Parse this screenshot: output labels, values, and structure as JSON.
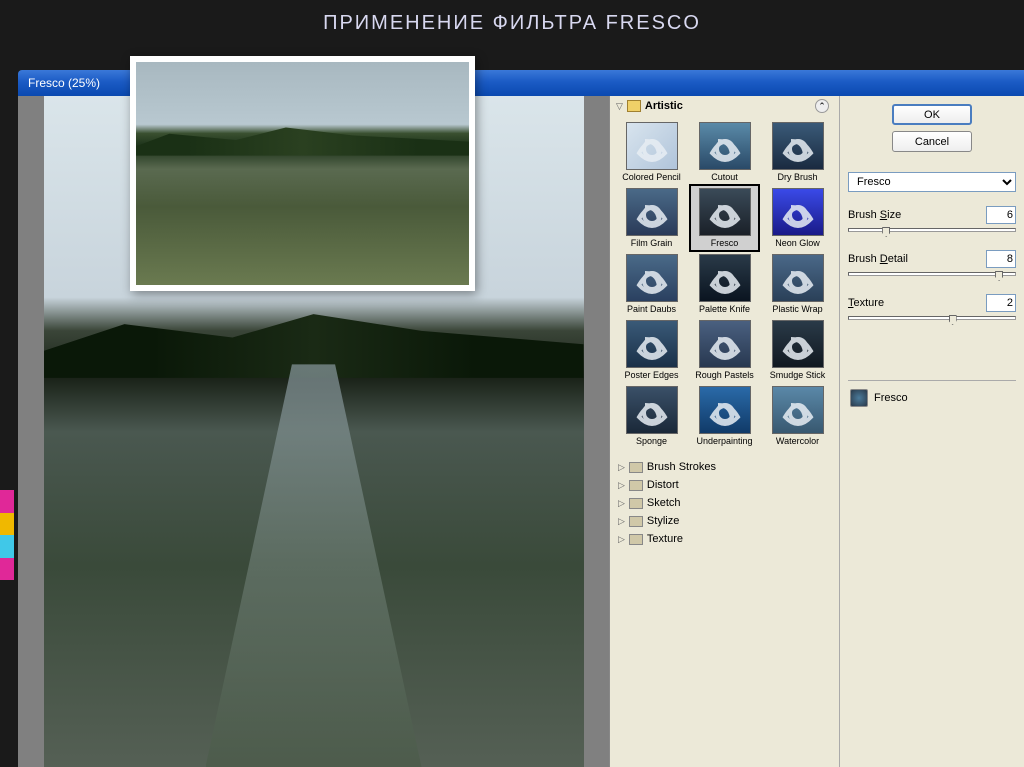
{
  "slide": {
    "title": "ПРИМЕНЕНИЕ ФИЛЬТРА FRESCO"
  },
  "window": {
    "title": "Fresco (25%)"
  },
  "panel": {
    "category_open": "Artistic",
    "filters": [
      "Colored Pencil",
      "Cutout",
      "Dry Brush",
      "Film Grain",
      "Fresco",
      "Neon Glow",
      "Paint Daubs",
      "Palette Knife",
      "Plastic Wrap",
      "Poster Edges",
      "Rough Pastels",
      "Smudge Stick",
      "Sponge",
      "Underpainting",
      "Watercolor"
    ],
    "selected_filter": "Fresco",
    "categories": [
      "Brush Strokes",
      "Distort",
      "Sketch",
      "Stylize",
      "Texture"
    ]
  },
  "settings": {
    "ok": "OK",
    "cancel": "Cancel",
    "filter_name": "Fresco",
    "params": [
      {
        "label": "Brush Size",
        "hotkey": "S",
        "value": "6",
        "pos": 20
      },
      {
        "label": "Brush Detail",
        "hotkey": "D",
        "value": "8",
        "pos": 88
      },
      {
        "label": "Texture",
        "hotkey": "T",
        "value": "2",
        "pos": 60
      }
    ],
    "preview_label": "Fresco"
  },
  "rainbow": [
    "#e02898",
    "#f0b800",
    "#40c8e8",
    "#e02898"
  ]
}
